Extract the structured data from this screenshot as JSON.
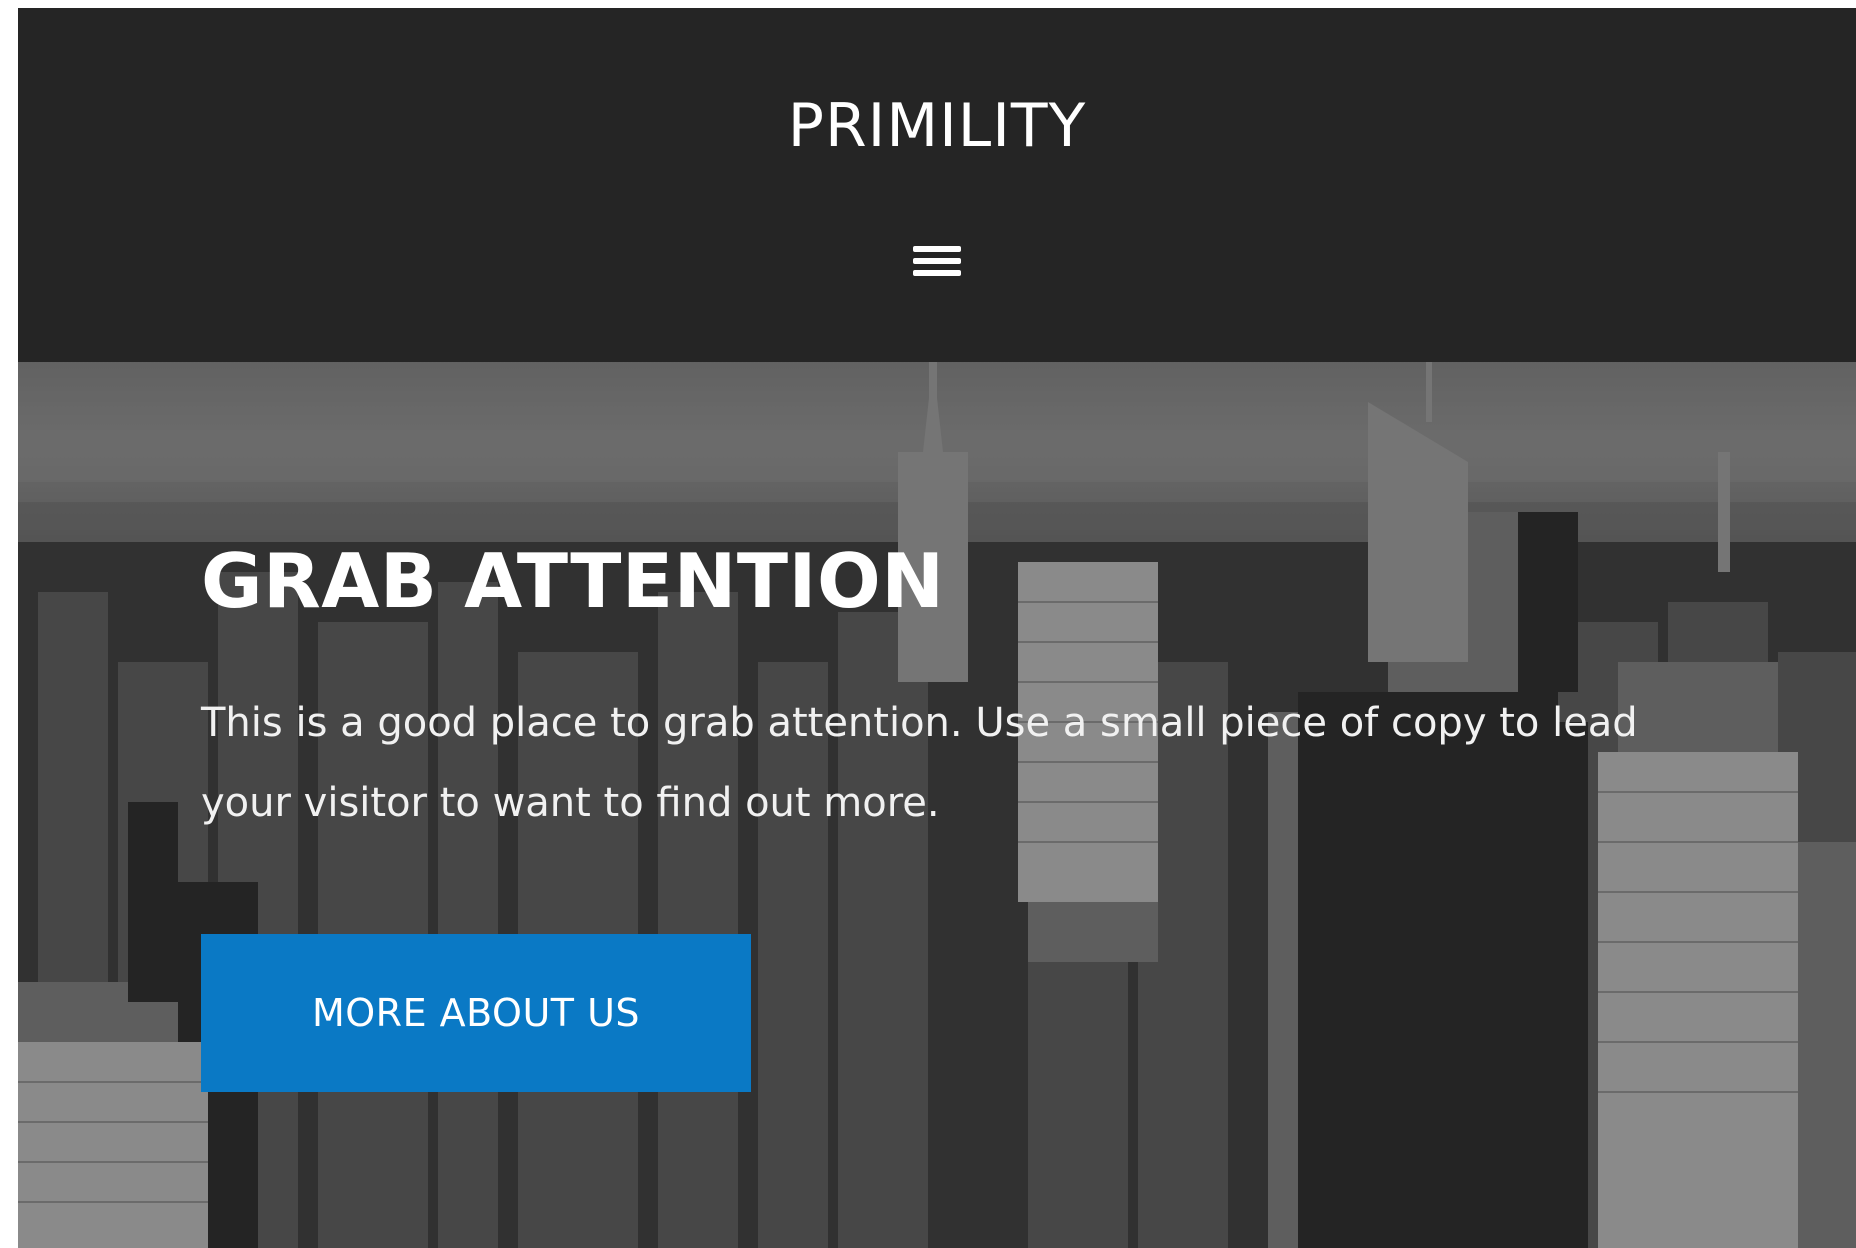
{
  "header": {
    "site_title": "PRIMILITY"
  },
  "hero": {
    "heading": "GRAB ATTENTION",
    "text": "This is a good place to grab attention. Use a small piece of copy to lead your visitor to want to find out more.",
    "button_label": "MORE ABOUT US"
  },
  "colors": {
    "header_bg": "#252525",
    "accent": "#0a79c5",
    "text": "#ffffff"
  },
  "icons": {
    "menu": "hamburger-menu-icon"
  }
}
